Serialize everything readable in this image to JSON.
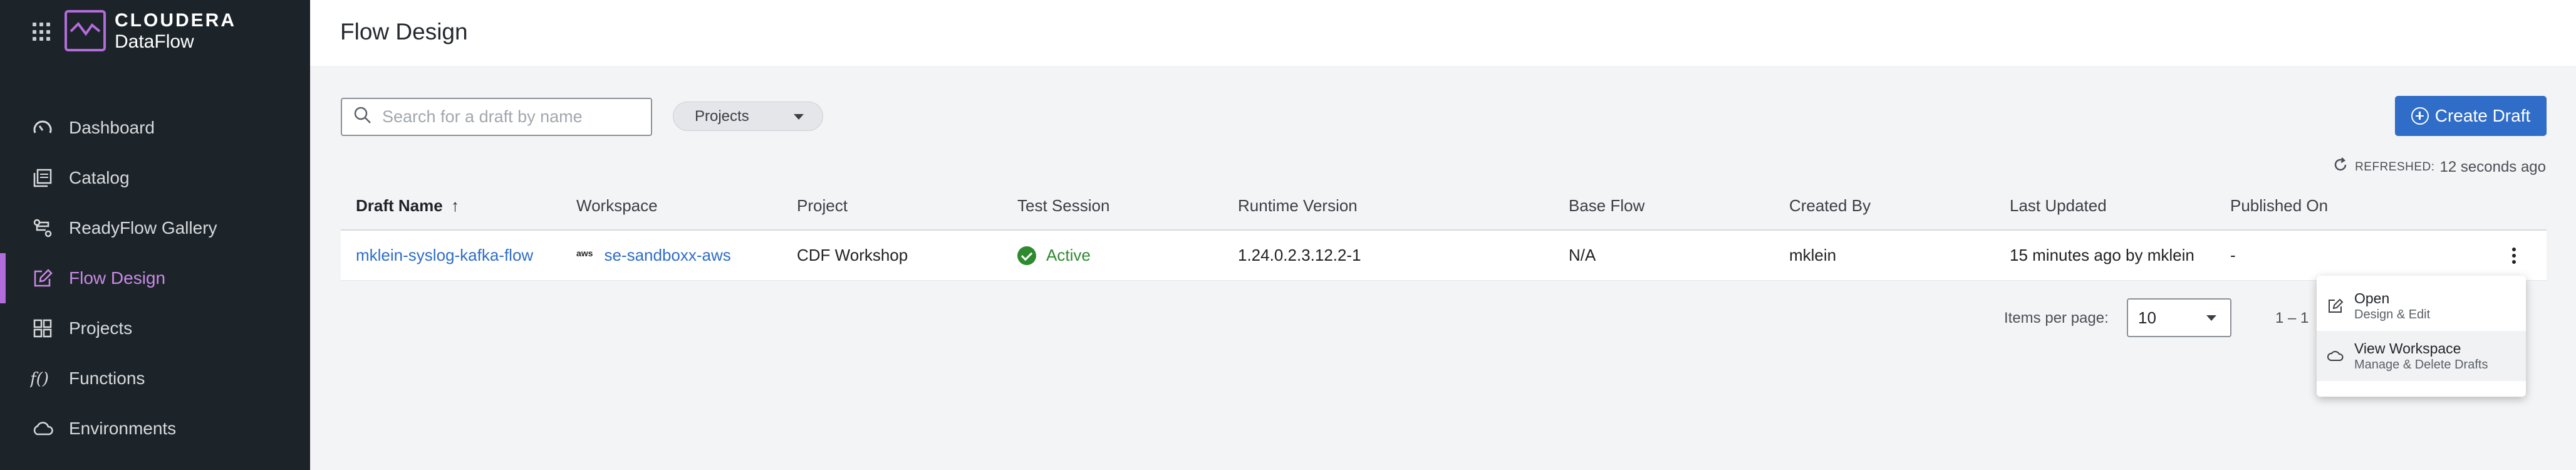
{
  "brand": {
    "line1": "CLOUDERA",
    "line2": "DataFlow"
  },
  "sidebar": {
    "items": [
      {
        "label": "Dashboard",
        "icon": "gauge-icon"
      },
      {
        "label": "Catalog",
        "icon": "catalog-icon"
      },
      {
        "label": "ReadyFlow Gallery",
        "icon": "flow-gallery-icon"
      },
      {
        "label": "Flow Design",
        "icon": "edit-icon",
        "active": true
      },
      {
        "label": "Projects",
        "icon": "grid-squares-icon"
      },
      {
        "label": "Functions",
        "icon": "function-icon"
      },
      {
        "label": "Environments",
        "icon": "cloud-icon"
      }
    ]
  },
  "header": {
    "title": "Flow Design"
  },
  "toolbar": {
    "search_placeholder": "Search for a draft by name",
    "projects_label": "Projects",
    "create_label": "Create Draft",
    "refreshed_label": "REFRESHED:",
    "refreshed_value": "12 seconds ago"
  },
  "table": {
    "columns": [
      "Draft Name",
      "Workspace",
      "Project",
      "Test Session",
      "Runtime Version",
      "Base Flow",
      "Created By",
      "Last Updated",
      "Published On"
    ],
    "sort_indicator": "↑",
    "rows": [
      {
        "draft_name": "mklein-syslog-kafka-flow",
        "workspace_badge": "aws",
        "workspace": "se-sandboxx-aws",
        "project": "CDF Workshop",
        "test_session": "Active",
        "runtime_version": "1.24.0.2.3.12.2-1",
        "base_flow": "N/A",
        "created_by": "mklein",
        "last_updated": "15 minutes ago by mklein",
        "published_on": "-"
      }
    ]
  },
  "pagination": {
    "items_label": "Items per page:",
    "per_page": "10",
    "range": "1 – 1"
  },
  "menu": {
    "items": [
      {
        "title": "Open",
        "subtitle": "Design & Edit"
      },
      {
        "title": "View Workspace",
        "subtitle": "Manage & Delete Drafts"
      }
    ]
  },
  "colors": {
    "sidebar_bg": "#1d2429",
    "accent_purple": "#b36cdc",
    "primary_blue": "#2f6dc9",
    "success_green": "#2f8a2f"
  }
}
